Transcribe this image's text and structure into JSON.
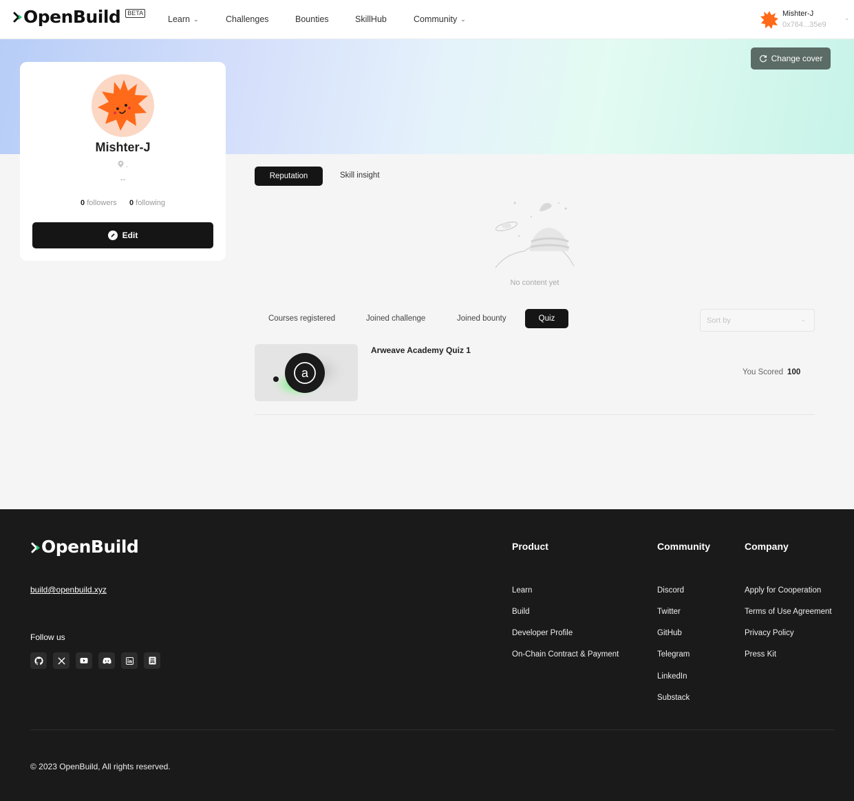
{
  "nav": {
    "logo": "OpenBuild",
    "beta": "BETA",
    "items": [
      {
        "label": "Learn",
        "dropdown": true
      },
      {
        "label": "Challenges",
        "dropdown": false
      },
      {
        "label": "Bounties",
        "dropdown": false
      },
      {
        "label": "SkillHub",
        "dropdown": false
      },
      {
        "label": "Community",
        "dropdown": true
      }
    ],
    "user": {
      "name": "Mishter-J",
      "address": "0x764...35e9"
    }
  },
  "cover": {
    "change_label": "Change cover"
  },
  "profile": {
    "name": "Mishter-J",
    "location": ".",
    "bio": "--",
    "followers_count": "0",
    "followers_label": "followers",
    "following_count": "0",
    "following_label": "following",
    "edit_label": "Edit"
  },
  "main_tabs": {
    "reputation": "Reputation",
    "skill_insight": "Skill insight",
    "active": "Reputation"
  },
  "empty_state": {
    "text": "No content yet"
  },
  "activity_tabs": {
    "items": [
      "Courses registered",
      "Joined challenge",
      "Joined bounty",
      "Quiz"
    ],
    "active": "Quiz"
  },
  "sort": {
    "placeholder": "Sort by"
  },
  "quiz": {
    "title": "Arweave Academy Quiz 1",
    "score_label": "You Scored",
    "score_value": "100",
    "thumb_letter": "a"
  },
  "footer": {
    "logo": "OpenBuild",
    "email": "build@openbuild.xyz",
    "follow_label": "Follow us",
    "socials": [
      "github-icon",
      "x-icon",
      "youtube-icon",
      "discord-icon",
      "linkedin-icon",
      "substack-icon"
    ],
    "product": {
      "title": "Product",
      "links": [
        "Learn",
        "Build",
        "Developer Profile",
        "On-Chain Contract & Payment"
      ]
    },
    "community": {
      "title": "Community",
      "links": [
        "Discord",
        "Twitter",
        "GitHub",
        "Telegram",
        "LinkedIn",
        "Substack"
      ]
    },
    "company": {
      "title": "Company",
      "links": [
        "Apply for Cooperation",
        "Terms of Use Agreement",
        "Privacy Policy",
        "Press Kit"
      ]
    },
    "copyright": "© 2023 OpenBuild, All rights reserved."
  },
  "colors": {
    "accent_green": "#1fc96b",
    "dark": "#151515",
    "avatar_orange": "#ff6a1a",
    "avatar_bg": "#fbd7c4"
  }
}
